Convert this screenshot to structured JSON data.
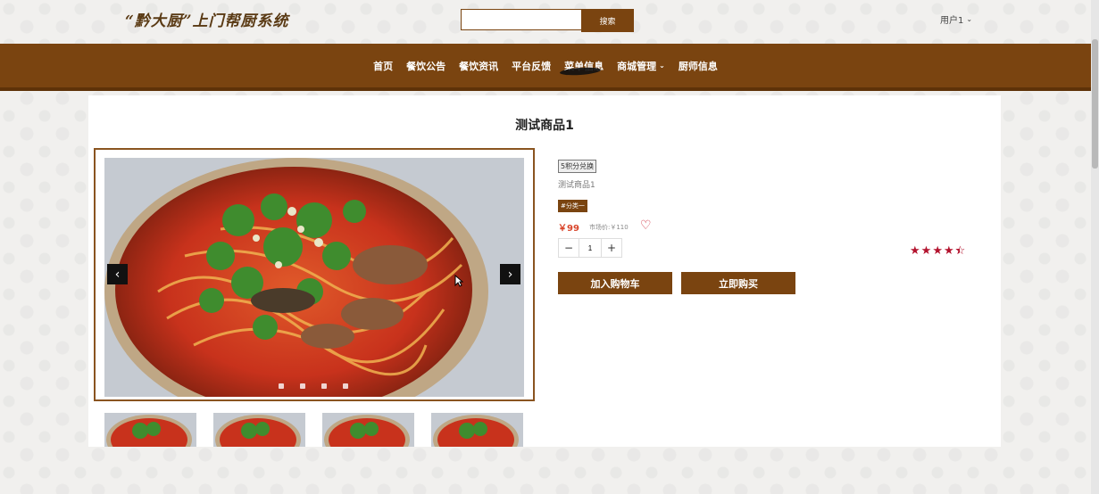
{
  "header": {
    "site_title": "“黔大厨”上门帮厨系统",
    "search_placeholder": "",
    "search_button": "搜索",
    "user_label": "用户1"
  },
  "nav": {
    "items": [
      "首页",
      "餐饮公告",
      "餐饮资讯",
      "平台反馈",
      "菜单信息",
      "商城管理",
      "厨师信息"
    ]
  },
  "product": {
    "title": "测试商品1",
    "points_badge": "5积分兑换",
    "description": "测试商品1",
    "category": "#分类一",
    "price": "￥99",
    "market_price": "市场价:￥110",
    "quantity": "1",
    "rating": 4.5,
    "add_to_cart": "加入购物车",
    "buy_now": "立即购买"
  },
  "gallery": {
    "prev_icon": "‹",
    "next_icon": "›",
    "slide_count": 4,
    "thumbnail_count": 4
  },
  "colors": {
    "brand": "#7a4410",
    "price": "#d9462c",
    "star": "#b3132e"
  }
}
